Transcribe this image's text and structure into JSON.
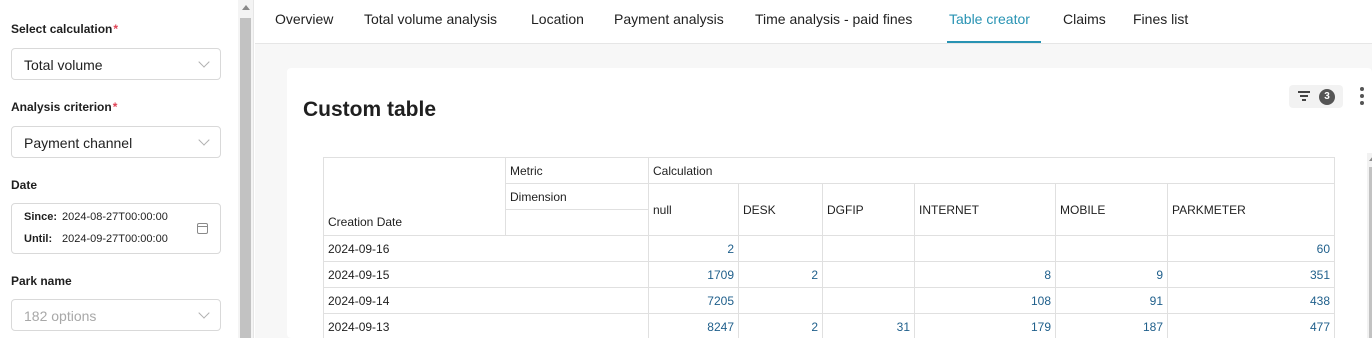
{
  "sidebar": {
    "calculation": {
      "label": "Select calculation",
      "required": "*",
      "value": "Total volume"
    },
    "criterion": {
      "label": "Analysis criterion",
      "required": "*",
      "value": "Payment channel"
    },
    "date": {
      "label": "Date",
      "since_label": "Since:",
      "since_value": "2024-08-27T00:00:00",
      "until_label": "Until:",
      "until_value": "2024-09-27T00:00:00"
    },
    "park": {
      "label": "Park name",
      "placeholder": "182 options"
    }
  },
  "tabs": [
    {
      "label": "Overview"
    },
    {
      "label": "Total volume analysis"
    },
    {
      "label": "Location"
    },
    {
      "label": "Payment analysis"
    },
    {
      "label": "Time analysis - paid fines"
    },
    {
      "label": "Table creator",
      "active": true
    },
    {
      "label": "Claims"
    },
    {
      "label": "Fines list"
    }
  ],
  "card": {
    "title": "Custom table",
    "filter_count": "3"
  },
  "table": {
    "metric_label": "Metric",
    "calculation_label": "Calculation",
    "dimension_label": "Dimension",
    "row_header": "Creation Date",
    "columns": [
      "null",
      "DESK",
      "DGFIP",
      "INTERNET",
      "MOBILE",
      "PARKMETER"
    ],
    "rows": [
      {
        "date": "2024-09-16",
        "values": [
          "2",
          "",
          "",
          "",
          "",
          "60"
        ]
      },
      {
        "date": "2024-09-15",
        "values": [
          "1709",
          "2",
          "",
          "8",
          "9",
          "351"
        ]
      },
      {
        "date": "2024-09-14",
        "values": [
          "7205",
          "",
          "",
          "108",
          "91",
          "438"
        ]
      },
      {
        "date": "2024-09-13",
        "values": [
          "8247",
          "2",
          "31",
          "179",
          "187",
          "477"
        ]
      }
    ]
  }
}
